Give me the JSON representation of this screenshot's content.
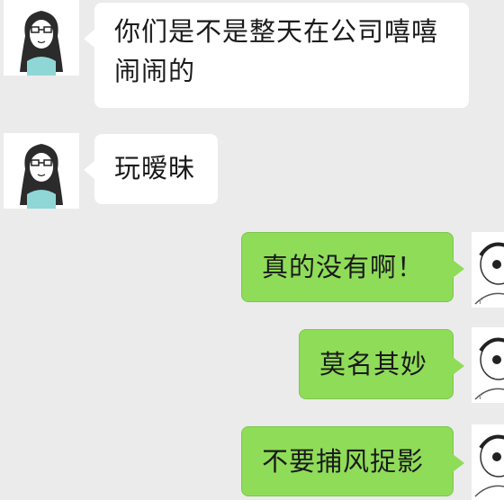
{
  "colors": {
    "background": "#ebebeb",
    "incoming_bubble": "#ffffff",
    "outgoing_bubble": "#8fdc59"
  },
  "messages": [
    {
      "side": "incoming",
      "line1": "你们是不是整天在公司嘻嘻",
      "line2": "闹闹的",
      "avatar": "girl-avatar-icon"
    },
    {
      "side": "incoming",
      "line1": "玩暧昧",
      "avatar": "girl-avatar-icon"
    },
    {
      "side": "outgoing",
      "line1": "真的没有啊！",
      "avatar": "boy-avatar-icon"
    },
    {
      "side": "outgoing",
      "line1": "莫名其妙",
      "avatar": "boy-avatar-icon"
    },
    {
      "side": "outgoing",
      "line1": "不要捕风捉影",
      "avatar": "boy-avatar-icon"
    }
  ]
}
